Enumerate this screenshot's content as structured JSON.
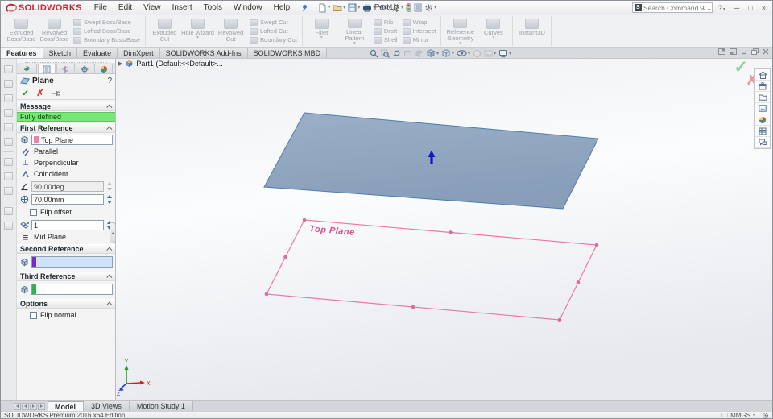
{
  "window": {
    "brand": "SOLIDWORKS",
    "title": "Part1 *",
    "search_placeholder": "Search Commands",
    "menus": [
      "File",
      "Edit",
      "View",
      "Insert",
      "Tools",
      "Window",
      "Help"
    ]
  },
  "ribbon": {
    "groups": [
      {
        "big": [
          "Extruded Boss/Base",
          "Revolved Boss/Base"
        ],
        "stack": [
          "Swept Boss/Base",
          "Lofted Boss/Base",
          "Boundary Boss/Base"
        ]
      },
      {
        "big": [
          "Extruded Cut",
          "Hole Wizard",
          "Revolved Cut"
        ],
        "stack": [
          "Swept Cut",
          "Lofted Cut",
          "Boundary Cut"
        ]
      },
      {
        "big": [
          "Fillet",
          "Linear Pattern"
        ],
        "stack": [
          "Rib",
          "Draft",
          "Shell"
        ],
        "stack2": [
          "Wrap",
          "Intersect",
          "Mirror"
        ]
      },
      {
        "big": [
          "Reference Geometry",
          "Curves"
        ]
      },
      {
        "big": [
          "Instant3D"
        ]
      }
    ]
  },
  "doc_tabs": [
    "Features",
    "Sketch",
    "Evaluate",
    "DimXpert",
    "SOLIDWORKS Add-Ins",
    "SOLIDWORKS MBD"
  ],
  "feature_tree": {
    "root": "Part1 (Default<<Default>..."
  },
  "pm": {
    "title": "Plane",
    "sections": {
      "message": "Message",
      "first": "First Reference",
      "second": "Second Reference",
      "third": "Third Reference",
      "options": "Options"
    },
    "status": "Fully defined",
    "first_ref_value": "Top Plane",
    "parallel": "Parallel",
    "perpendicular": "Perpendicular",
    "coincident": "Coincident",
    "angle": "90.00deg",
    "offset": "70.00mm",
    "flip_offset": "Flip offset",
    "count": "1",
    "mid_plane": "Mid Plane",
    "flip_normal": "Flip normal"
  },
  "viewport": {
    "plane_label": "Top Plane",
    "axis_x": "X",
    "axis_y": "Y",
    "axis_z": "Z"
  },
  "bottom_tabs": [
    "Model",
    "3D Views",
    "Motion Study 1"
  ],
  "status_bar": {
    "edition": "SOLIDWORKS Premium 2016 x64 Edition",
    "units": "MMGS"
  },
  "icons": {
    "check": "✓",
    "cancel": "✗",
    "help": "?",
    "minimize": "─",
    "restore": "□",
    "close": "×",
    "expand_arrow": "▶",
    "mid_plane_glyph": "≡",
    "perpendicular_glyph": "⊥"
  },
  "colors": {
    "brand_red": "#cf2030",
    "status_green": "#76e876",
    "plane_fill": "#8ba2bd",
    "plane_edge": "#4f7cb2",
    "highlight_pink": "#e87aa6",
    "swatch_pink": "#f07eb0",
    "arrow_blue": "#1616c8",
    "second_ref_bar": "#7d26cd",
    "third_ref_bar": "#2fb14c"
  }
}
